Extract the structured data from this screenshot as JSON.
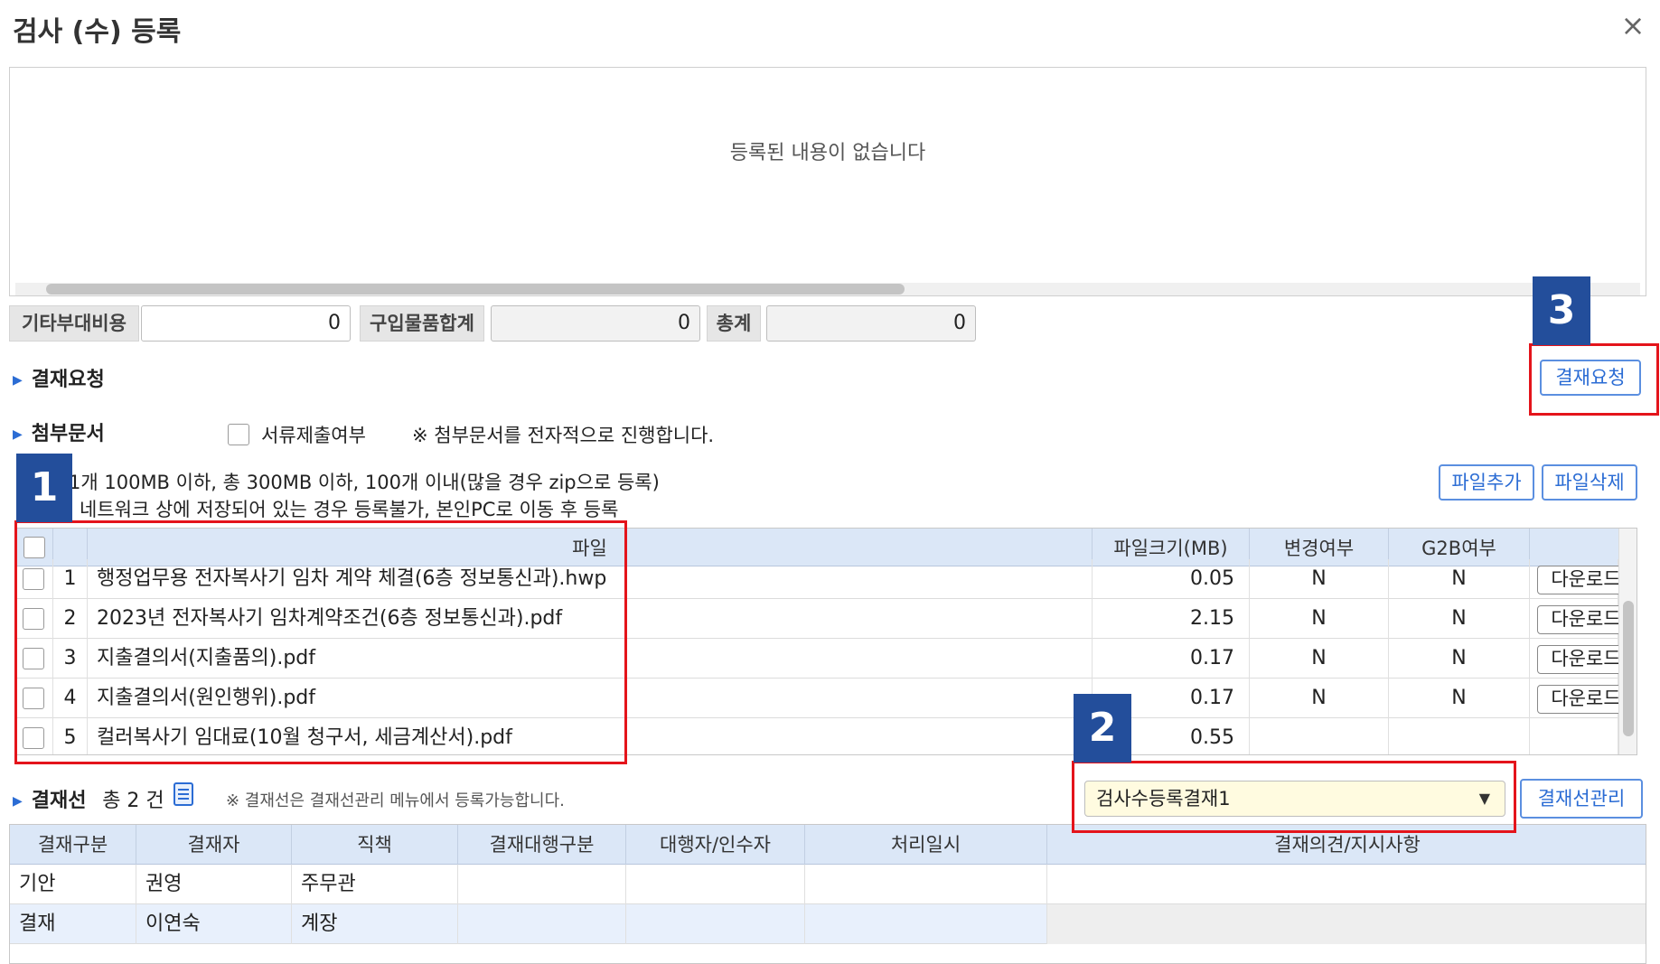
{
  "dialog": {
    "title": "검사 (수) 등록",
    "close": "×",
    "empty_message": "등록된 내용이 없습니다"
  },
  "costs": {
    "other_label": "기타부대비용",
    "other_value": "0",
    "purchase_label": "구입물품합계",
    "purchase_value": "0",
    "total_label": "총계",
    "total_value": "0"
  },
  "approval_request": {
    "section_label": "결재요청",
    "button": "결재요청"
  },
  "attachments": {
    "section_label": "첨부문서",
    "checkbox_label": "서류제출여부",
    "electronic_note": "※ 첨부문서를 전자적으로 진행합니다.",
    "limit_note": "1개 100MB 이하, 총 300MB 이하, 100개 이내(많을 경우 zip으로 등록)",
    "network_note": "네트워크 상에 저장되어 있는 경우 등록불가, 본인PC로 이동 후 등록",
    "add_button": "파일추가",
    "delete_button": "파일삭제",
    "columns": [
      "파일",
      "파일크기(MB)",
      "변경여부",
      "G2B여부"
    ],
    "download_label": "다운로드",
    "rows": [
      {
        "no": "1",
        "name": "행정업무용 전자복사기 임차 계약 체결(6층 정보통신과).hwp",
        "size": "0.05",
        "changed": "N",
        "g2b": "N"
      },
      {
        "no": "2",
        "name": "2023년 전자복사기 임차계약조건(6층 정보통신과).pdf",
        "size": "2.15",
        "changed": "N",
        "g2b": "N"
      },
      {
        "no": "3",
        "name": "지출결의서(지출품의).pdf",
        "size": "0.17",
        "changed": "N",
        "g2b": "N"
      },
      {
        "no": "4",
        "name": "지출결의서(원인행위).pdf",
        "size": "0.17",
        "changed": "N",
        "g2b": "N"
      },
      {
        "no": "5",
        "name": "컬러복사기 임대료(10월 청구서, 세금계산서).pdf",
        "size": "0.55",
        "changed": "",
        "g2b": ""
      }
    ]
  },
  "approval_line": {
    "section_label": "결재선",
    "count_text": "총 2 건",
    "note": "※ 결재선은 결재선관리 메뉴에서 등록가능합니다.",
    "selected": "검사수등록결재1",
    "manage_button": "결재선관리",
    "columns": [
      "결재구분",
      "결재자",
      "직책",
      "결재대행구분",
      "대행자/인수자",
      "처리일시",
      "결재의견/지시사항"
    ],
    "rows": [
      {
        "type": "기안",
        "approver": "권영",
        "position": "주무관"
      },
      {
        "type": "결재",
        "approver": "이연숙",
        "position": "계장"
      }
    ]
  },
  "annotations": {
    "badge1": "1",
    "badge2": "2",
    "badge3": "3",
    "highlight_color": "#e4141b",
    "badge_color": "#234e9b"
  },
  "colors": {
    "accent": "#2b6cd4",
    "header_bg": "#dbe7f7",
    "select_bg": "#fffbe0"
  }
}
